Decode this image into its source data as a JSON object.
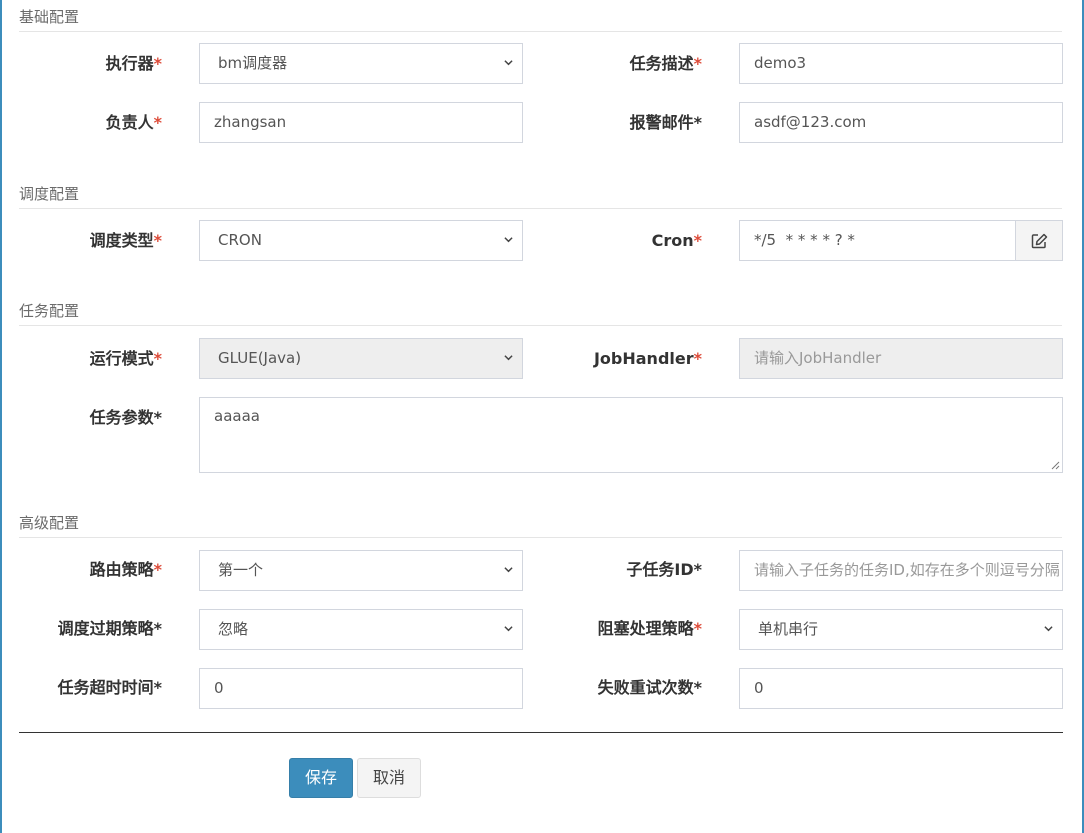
{
  "sections": {
    "basic": "基础配置",
    "schedule": "调度配置",
    "task": "任务配置",
    "advanced": "高级配置"
  },
  "fields": {
    "executor": {
      "label": "执行器",
      "required_mark": "*",
      "value": "bm调度器"
    },
    "job_desc": {
      "label": "任务描述",
      "required_mark": "*",
      "value": "demo3"
    },
    "author": {
      "label": "负责人",
      "required_mark": "*",
      "value": "zhangsan"
    },
    "alarm_email": {
      "label": "报警邮件*",
      "value": "asdf@123.com"
    },
    "schedule_type": {
      "label": "调度类型",
      "required_mark": "*",
      "value": "CRON"
    },
    "cron": {
      "label": "Cron",
      "required_mark": "*",
      "value": "*/5  * * * * ? *"
    },
    "glue_type": {
      "label": "运行模式",
      "required_mark": "*",
      "value": "GLUE(Java)"
    },
    "job_handler": {
      "label": "JobHandler",
      "required_mark": "*",
      "placeholder": "请输入JobHandler"
    },
    "job_param": {
      "label": "任务参数*",
      "value": "aaaaa"
    },
    "route_strategy": {
      "label": "路由策略",
      "required_mark": "*",
      "value": "第一个"
    },
    "child_job_id": {
      "label": "子任务ID*",
      "placeholder": "请输入子任务的任务ID,如存在多个则逗号分隔"
    },
    "misfire_strategy": {
      "label": "调度过期策略*",
      "value": "忽略"
    },
    "block_strategy": {
      "label": "阻塞处理策略",
      "required_mark": "*",
      "value": "单机串行"
    },
    "timeout": {
      "label": "任务超时时间*",
      "value": "0"
    },
    "fail_retry": {
      "label": "失败重试次数*",
      "value": "0"
    }
  },
  "buttons": {
    "save": "保存",
    "cancel": "取消"
  },
  "icons": {
    "cron_edit": "edit-icon",
    "dropdown": "chevron-down-icon"
  },
  "colors": {
    "primary": "#3c8dbc",
    "required": "#dd4b39",
    "border": "#d2d6de"
  }
}
